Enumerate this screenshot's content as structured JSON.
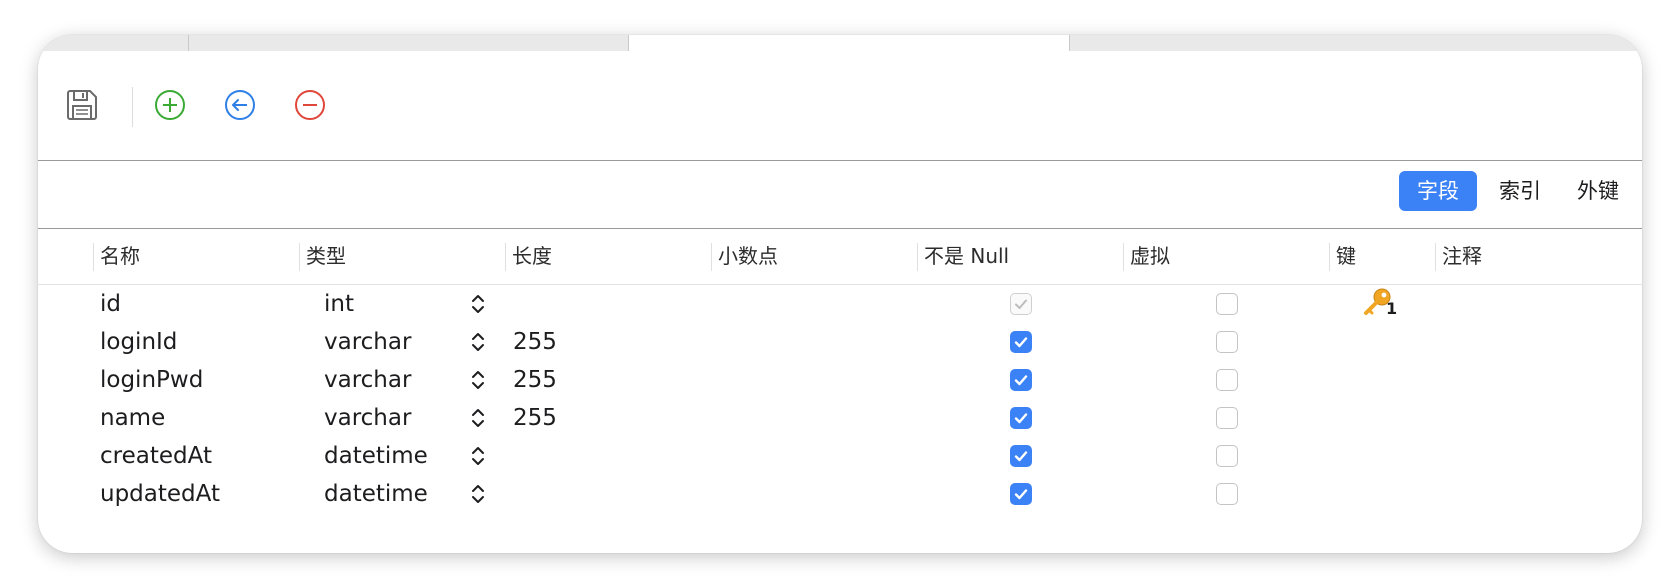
{
  "toolbar": {
    "buttons": [
      {
        "name": "save",
        "icon": "save-icon"
      },
      {
        "name": "add-field",
        "icon": "plus-circle-icon",
        "color": "#3aaa35"
      },
      {
        "name": "insert-field",
        "icon": "arrow-left-circle-icon",
        "color": "#2f7fe6"
      },
      {
        "name": "delete-field",
        "icon": "minus-circle-icon",
        "color": "#e0473b"
      }
    ]
  },
  "segments": {
    "items": [
      "字段",
      "索引",
      "外键"
    ],
    "selected": "字段"
  },
  "columns": {
    "name": "名称",
    "type": "类型",
    "length": "长度",
    "decimals": "小数点",
    "not_null": "不是 Null",
    "virtual": "虚拟",
    "key": "键",
    "comment": "注释"
  },
  "fields": [
    {
      "name": "id",
      "type": "int",
      "length": "",
      "decimals": "",
      "not_null": true,
      "not_null_disabled": true,
      "virtual": false,
      "key": "1",
      "comment": ""
    },
    {
      "name": "loginId",
      "type": "varchar",
      "length": "255",
      "decimals": "",
      "not_null": true,
      "not_null_disabled": false,
      "virtual": false,
      "key": "",
      "comment": ""
    },
    {
      "name": "loginPwd",
      "type": "varchar",
      "length": "255",
      "decimals": "",
      "not_null": true,
      "not_null_disabled": false,
      "virtual": false,
      "key": "",
      "comment": ""
    },
    {
      "name": "name",
      "type": "varchar",
      "length": "255",
      "decimals": "",
      "not_null": true,
      "not_null_disabled": false,
      "virtual": false,
      "key": "",
      "comment": ""
    },
    {
      "name": "createdAt",
      "type": "datetime",
      "length": "",
      "decimals": "",
      "not_null": true,
      "not_null_disabled": false,
      "virtual": false,
      "key": "",
      "comment": ""
    },
    {
      "name": "updatedAt",
      "type": "datetime",
      "length": "",
      "decimals": "",
      "not_null": true,
      "not_null_disabled": false,
      "virtual": false,
      "key": "",
      "comment": ""
    }
  ],
  "colors": {
    "accent": "#3b82f6",
    "key_icon": "#f0a623"
  }
}
